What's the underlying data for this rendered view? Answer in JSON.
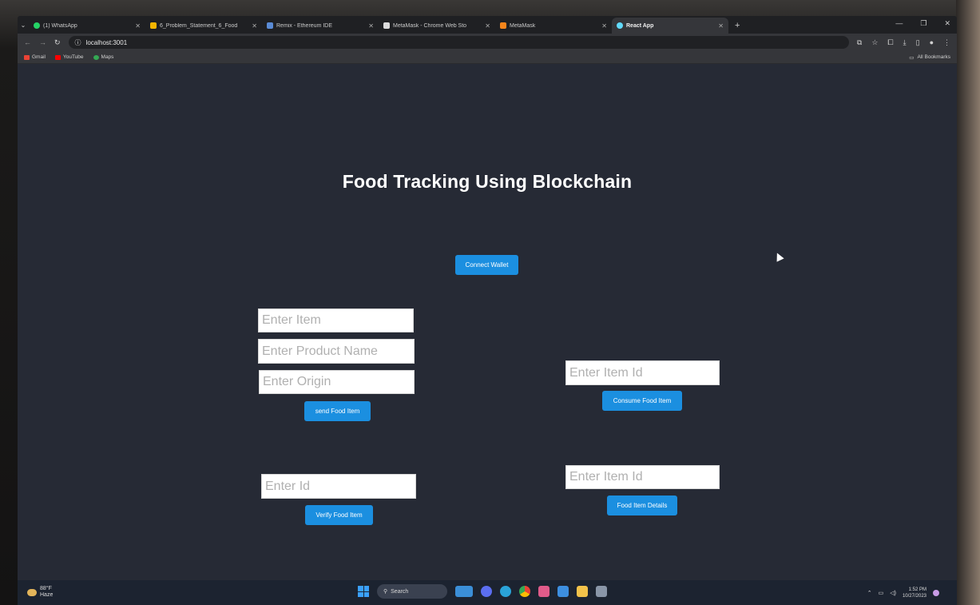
{
  "browser": {
    "tabs": [
      {
        "label": "(1) WhatsApp",
        "color": "#25d366",
        "active": false
      },
      {
        "label": "6_Problem_Statement_6_Food",
        "color": "#f3b400",
        "active": false
      },
      {
        "label": "Remix - Ethereum IDE",
        "color": "#5a8bd6",
        "active": false
      },
      {
        "label": "MetaMask - Chrome Web Sto",
        "color": "#dcdcdc",
        "active": false
      },
      {
        "label": "MetaMask",
        "color": "#f6851b",
        "active": false
      },
      {
        "label": "React App",
        "color": "#61dafb",
        "active": true
      }
    ],
    "new_tab": "+",
    "url": "localhost:3001",
    "bookmarks": [
      {
        "label": "Gmail",
        "color": "#ea4335"
      },
      {
        "label": "YouTube",
        "color": "#ff0000"
      },
      {
        "label": "Maps",
        "color": "#34a853"
      }
    ],
    "all_bookmarks": "All Bookmarks"
  },
  "page": {
    "title": "Food Tracking Using Blockchain",
    "connect_wallet": "Connect Wallet",
    "add_form": {
      "item_placeholder": "Enter Item",
      "product_placeholder": "Enter Product Name",
      "origin_placeholder": "Enter Origin",
      "send_button": "send Food Item"
    },
    "consume_form": {
      "id_placeholder": "Enter Item Id",
      "consume_button": "Consume Food Item"
    },
    "verify_form": {
      "id_placeholder": "Enter Id",
      "verify_button": "Verify Food Item"
    },
    "details_form": {
      "id_placeholder": "Enter Item Id",
      "details_button": "Food Item Details"
    }
  },
  "taskbar": {
    "weather_temp": "88°F",
    "weather_desc": "Haze",
    "search_label": "Search",
    "time": "1:52 PM",
    "date": "10/27/2023"
  },
  "colors": {
    "page_bg": "#262a35",
    "button": "#1b8fe0"
  }
}
